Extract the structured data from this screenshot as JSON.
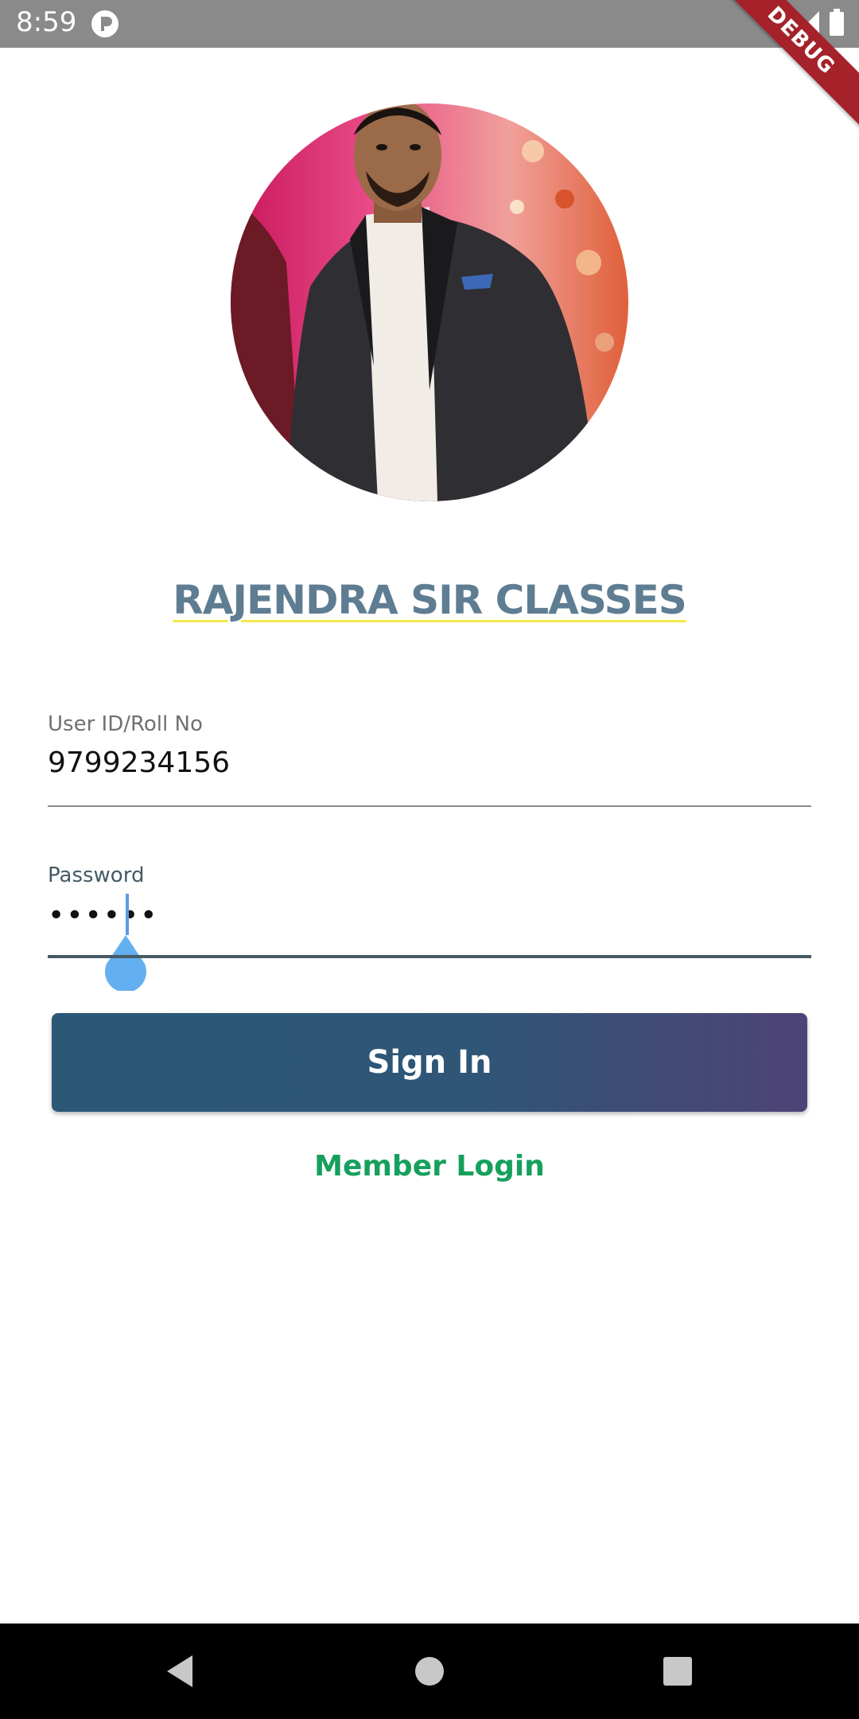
{
  "status_bar": {
    "time": "8:59",
    "app_icon": "pocket-casts-style-icon",
    "icons": [
      "wifi-icon",
      "cellular-signal-icon",
      "battery-icon"
    ]
  },
  "debug_banner": "DEBUG",
  "profile": {
    "photo_description_icon": "profile-photo"
  },
  "brand": {
    "title": "RAJENDRA SIR CLASSES"
  },
  "login_form": {
    "userid": {
      "label": "User ID/Roll No",
      "value": "9799234156"
    },
    "password": {
      "label": "Password",
      "value": "••••••"
    },
    "sign_in_label": "Sign In",
    "member_login_label": "Member Login"
  },
  "nav_bar": {
    "buttons": [
      "back-icon",
      "home-icon",
      "recents-icon"
    ]
  },
  "colors": {
    "status_bar": "#8a8a8a",
    "title": "#5f7d92",
    "button_gradient_start": "#2b5876",
    "button_gradient_end": "#4e4376",
    "member_login": "#16a05d",
    "cursor": "#5b9be8"
  }
}
